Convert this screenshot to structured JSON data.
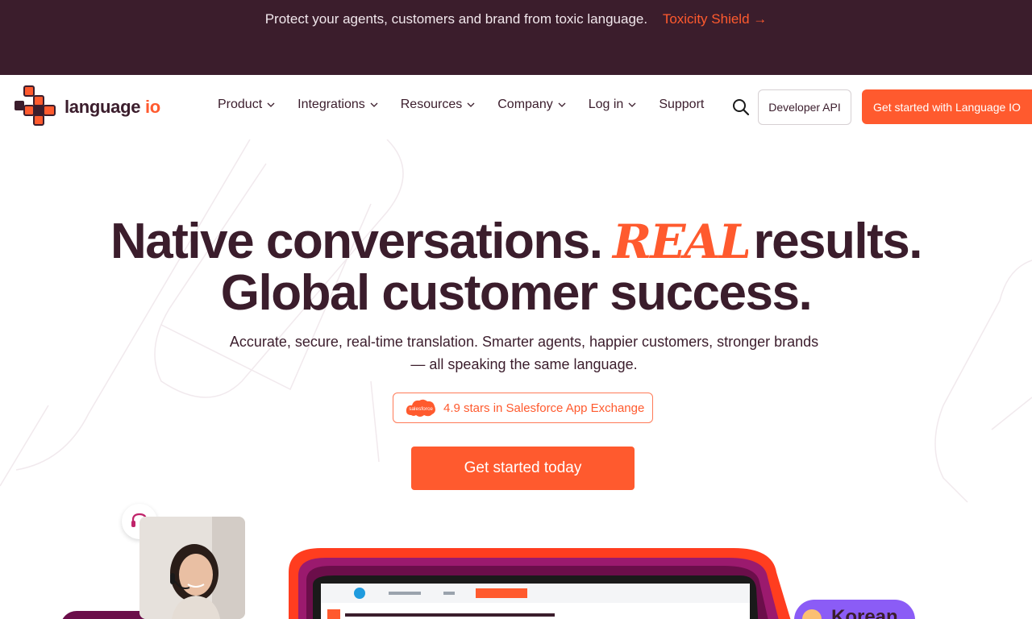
{
  "announcement": {
    "text": "Protect your agents, customers and brand from toxic language.",
    "link_label": "Toxicity Shield →"
  },
  "nav": {
    "logo_text": "language",
    "logo_io": "io",
    "items": [
      {
        "label": "Product",
        "has_dropdown": true
      },
      {
        "label": "Integrations",
        "has_dropdown": true
      },
      {
        "label": "Resources",
        "has_dropdown": true
      },
      {
        "label": "Company",
        "has_dropdown": true
      },
      {
        "label": "Log in",
        "has_dropdown": true
      },
      {
        "label": "Support",
        "has_dropdown": false
      }
    ],
    "search_icon": "search-icon",
    "developer_api_label": "Developer API",
    "get_started_label": "Get started with Language IO"
  },
  "hero": {
    "line1_start": "Native conversations.",
    "line1_script": "REAL",
    "line1_end": "results.",
    "line2": "Global customer success.",
    "subtitle_line1": "Accurate, secure, real-time translation. Smarter agents, happier customers, stronger brands",
    "subtitle_line2": "— all speaking the same language.",
    "badge_logo_text": "salesforce",
    "badge_text": "4.9 stars in Salesforce App Exchange",
    "cta_label": "Get started today"
  },
  "preview": {
    "korean_label": "Korean"
  },
  "colors": {
    "brand_dark": "#3b1d2c",
    "accent": "#ff5a2e",
    "purple": "#8b5cf6"
  }
}
